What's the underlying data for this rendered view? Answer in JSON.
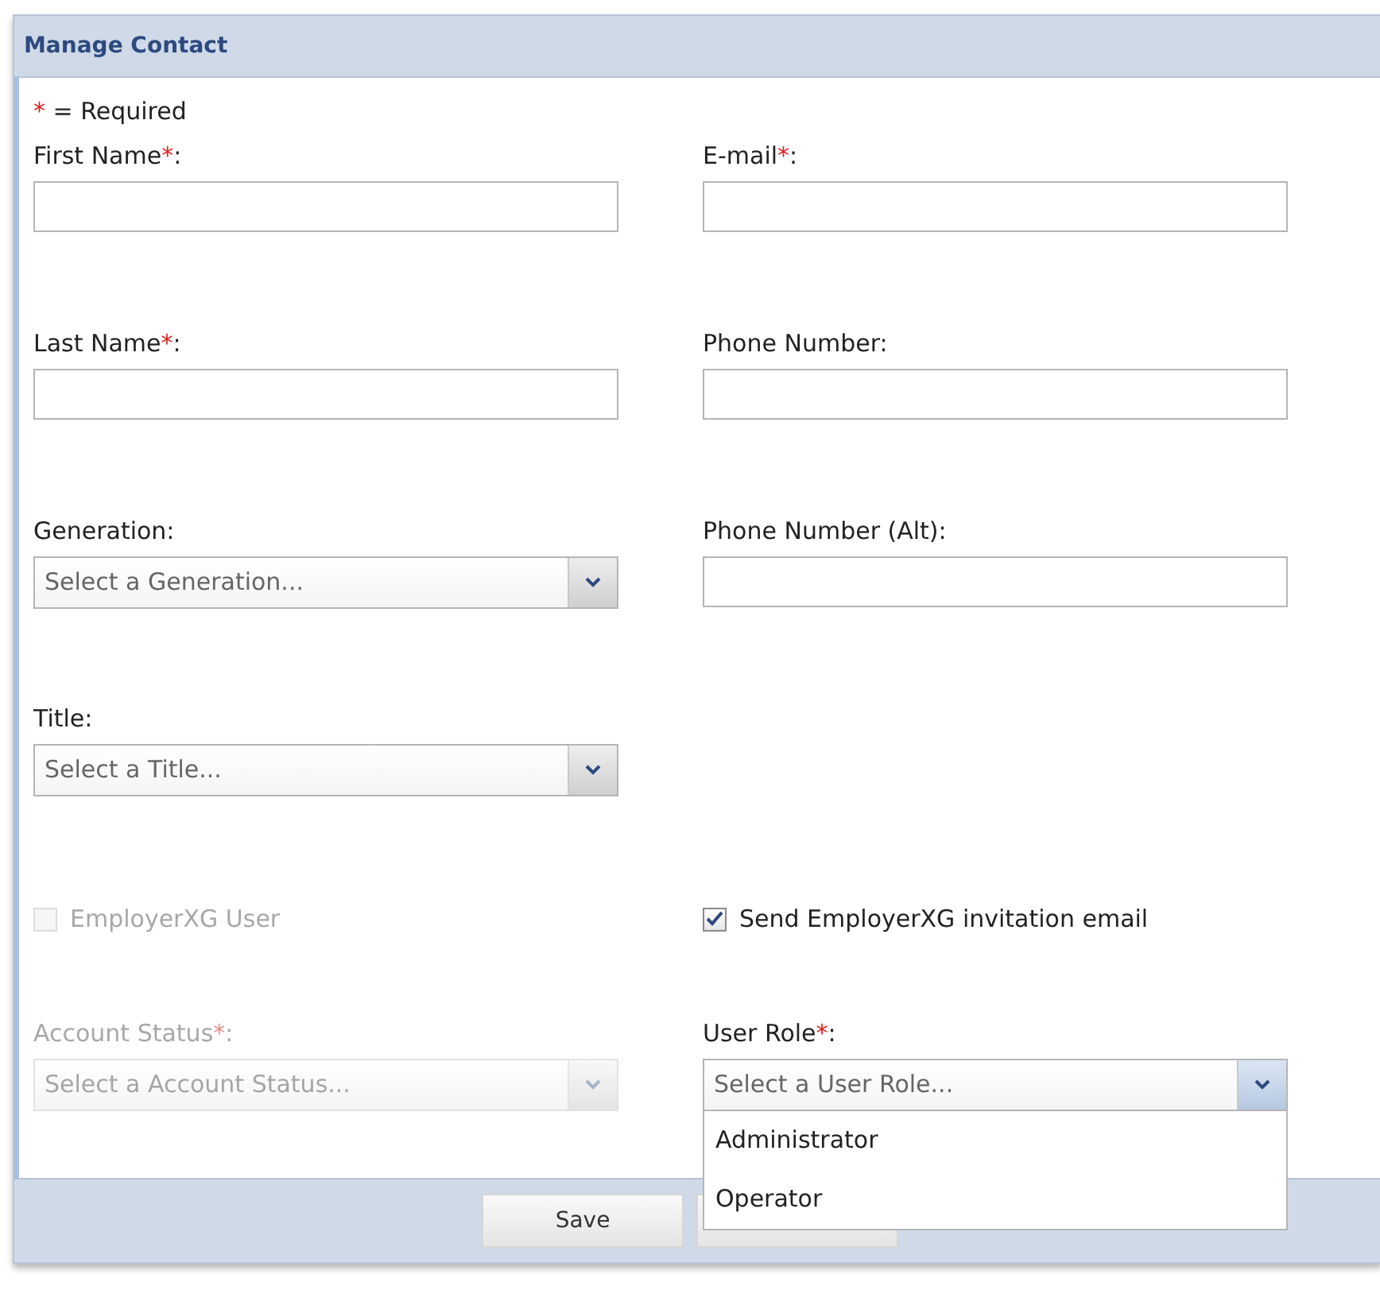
{
  "window": {
    "title": "Manage Contact"
  },
  "required_note": {
    "mark": "*",
    "text": "= Required"
  },
  "rows": [
    {
      "left": {
        "kind": "text",
        "label": "First Name",
        "required_mark": "*",
        "label_end": ":"
      },
      "right": {
        "kind": "text",
        "label": "E-mail",
        "required_mark": "*",
        "label_end": ":"
      }
    },
    {
      "left": {
        "kind": "text",
        "label": "Last Name",
        "required_mark": "*",
        "label_end": ":"
      },
      "right": {
        "kind": "text",
        "label": "Phone Number:"
      }
    },
    {
      "left": {
        "kind": "select",
        "label": "Generation:",
        "placeholder": "Select a Generation...",
        "disabled": false,
        "open": false
      },
      "right": {
        "kind": "text",
        "label": "Phone Number (Alt):"
      }
    },
    {
      "left": {
        "kind": "select",
        "label": "Title:",
        "placeholder": "Select a Title...",
        "disabled": false,
        "open": false
      }
    },
    {
      "left": {
        "kind": "checkbox",
        "label": "EmployerXG User",
        "checked": false,
        "disabled": true
      },
      "right": {
        "kind": "checkbox",
        "label": "Send EmployerXG invitation email",
        "checked": true,
        "disabled": false
      }
    },
    {
      "left": {
        "kind": "select",
        "label": "Account Status",
        "required_mark": "*",
        "label_end": ":",
        "placeholder": "Select a Account Status...",
        "disabled": true,
        "open": false
      },
      "right": {
        "kind": "select",
        "label": "User Role",
        "required_mark": "*",
        "label_end": ":",
        "placeholder": "Select a User Role...",
        "disabled": false,
        "open": true,
        "options": [
          "Administrator",
          "Operator"
        ]
      }
    }
  ],
  "buttons": [
    {
      "kind": "labeled",
      "label": "Save"
    },
    {
      "kind": "covered"
    }
  ]
}
